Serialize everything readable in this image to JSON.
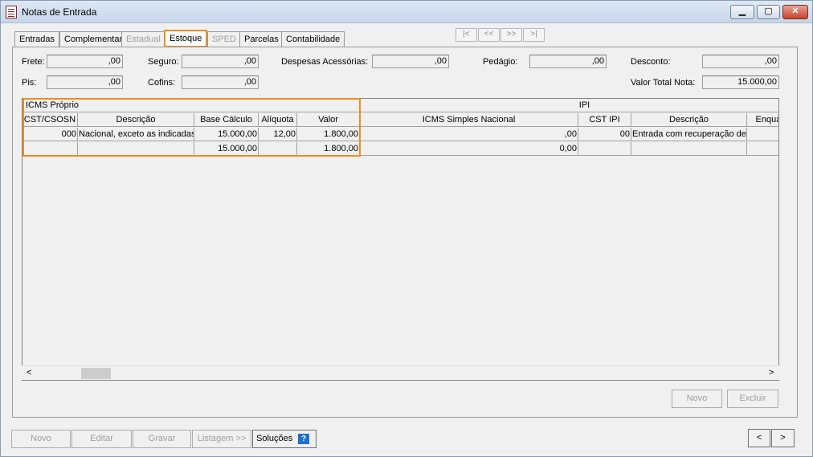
{
  "window": {
    "title": "Notas de Entrada"
  },
  "tabs": [
    {
      "label": "Entradas",
      "state": "normal"
    },
    {
      "label": "Complementar",
      "state": "normal"
    },
    {
      "label": "Estadual",
      "state": "disabled"
    },
    {
      "label": "Estoque",
      "state": "active"
    },
    {
      "label": "SPED",
      "state": "disabled"
    },
    {
      "label": "Parcelas",
      "state": "normal"
    },
    {
      "label": "Contabilidade",
      "state": "normal"
    }
  ],
  "record_nav": {
    "first": "|<",
    "prev": "<<",
    "next": ">>",
    "last": ">|"
  },
  "fields": {
    "frete": {
      "label": "Frete:",
      "value": ",00"
    },
    "seguro": {
      "label": "Seguro:",
      "value": ",00"
    },
    "despesas": {
      "label": "Despesas Acessórias:",
      "value": ",00"
    },
    "pedagio": {
      "label": "Pedágio:",
      "value": ",00"
    },
    "desconto": {
      "label": "Desconto:",
      "value": ",00"
    },
    "pis": {
      "label": "Pis:",
      "value": ",00"
    },
    "cofins": {
      "label": "Cofins:",
      "value": ",00"
    },
    "valor_total": {
      "label": "Valor Total Nota:",
      "value": "15.000,00"
    }
  },
  "grid": {
    "group_headers": {
      "icms_proprio": "ICMS Próprio",
      "ipi": "IPI"
    },
    "columns": [
      "CST/CSOSN",
      "Descrição",
      "Base Cálculo",
      "Alíquota",
      "Valor",
      "ICMS Simples Nacional",
      "CST IPI",
      "Descrição",
      "Enquad"
    ],
    "rows": [
      [
        "000",
        "Nacional, exceto as indicadas",
        "15.000,00",
        "12,00",
        "1.800,00",
        ",00",
        "00",
        "Entrada com recuperação de",
        ""
      ],
      [
        "",
        "",
        "15.000,00",
        "",
        "1.800,00",
        "0,00",
        "",
        "",
        ""
      ]
    ]
  },
  "panel_buttons": {
    "novo": "Novo",
    "excluir": "Excluir"
  },
  "bottom_buttons": {
    "novo": "Novo",
    "editar": "Editar",
    "gravar": "Gravar",
    "listagem": "Listagem >>",
    "solucoes": "Soluções",
    "help": "?"
  },
  "pager": {
    "prev": "<",
    "next": ">"
  },
  "scroll": {
    "left": "<",
    "right": ">"
  },
  "colors": {
    "highlight": "#f28c1a",
    "help_icon": "#1f6fd1"
  }
}
